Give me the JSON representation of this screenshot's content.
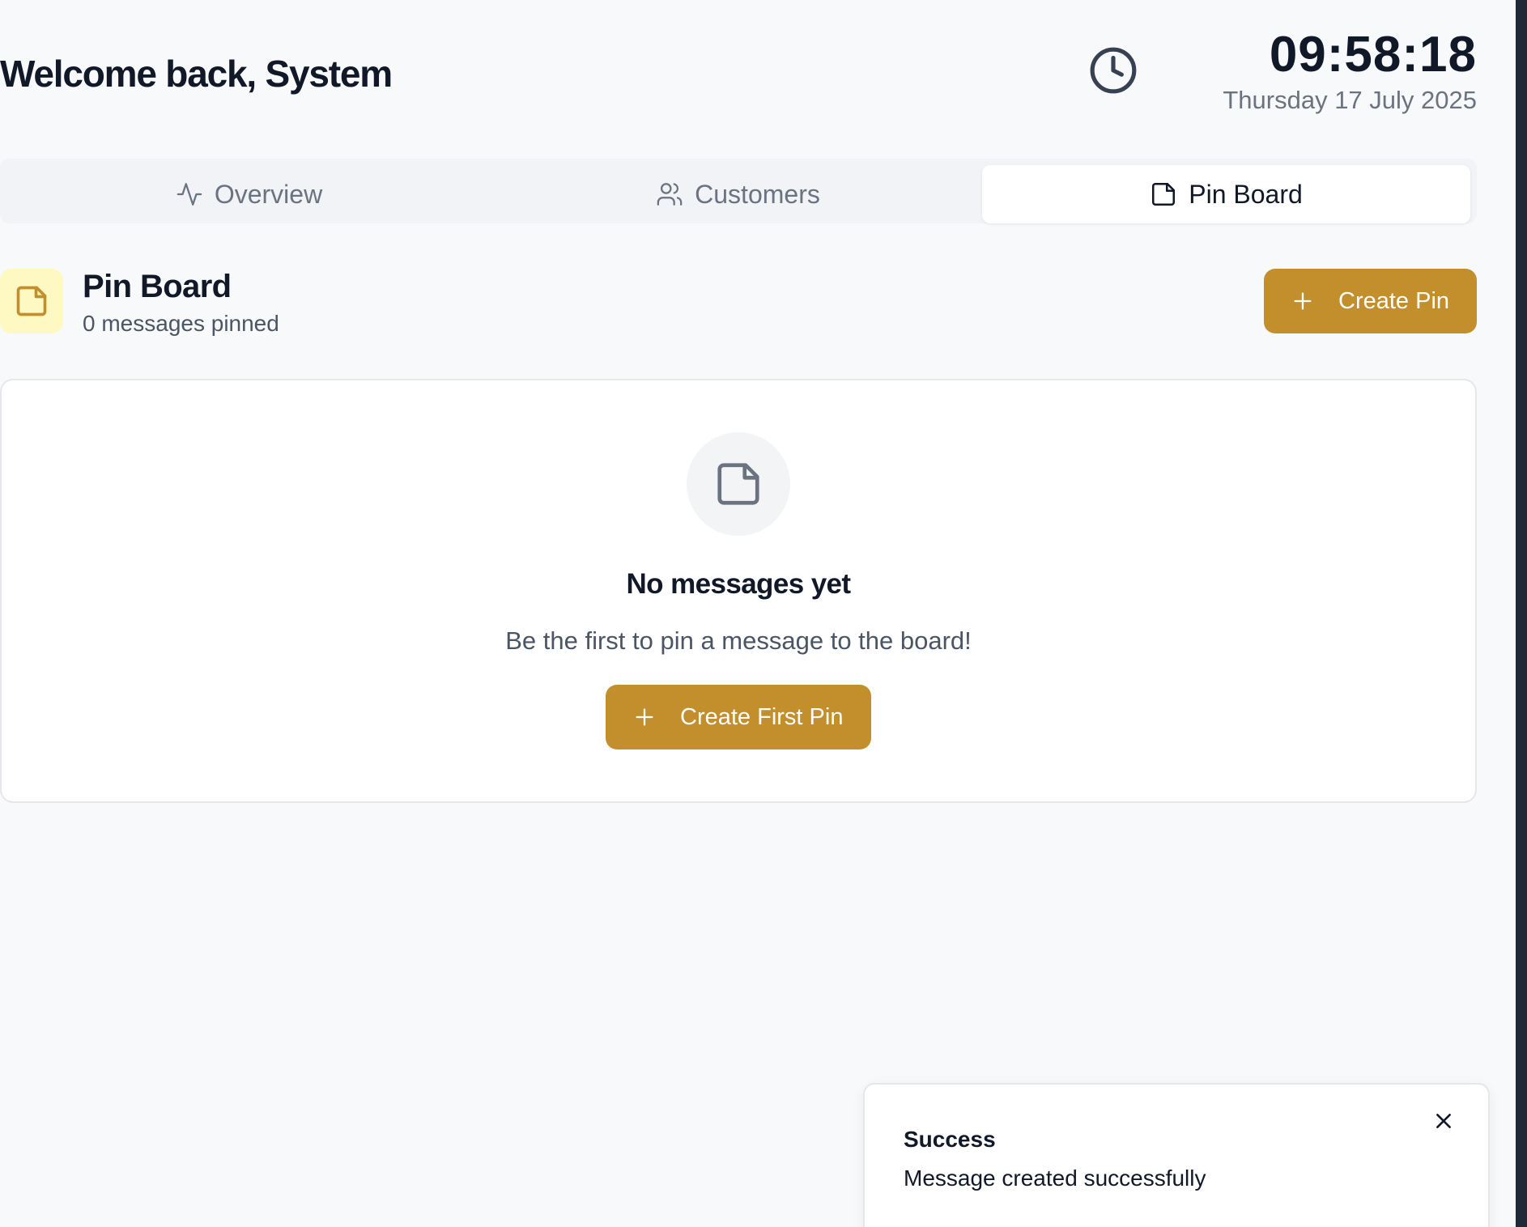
{
  "header": {
    "welcome": "Welcome back, System",
    "time": "09:58:18",
    "date": "Thursday 17 July 2025"
  },
  "tabs": [
    {
      "label": "Overview",
      "icon": "activity-icon",
      "active": false
    },
    {
      "label": "Customers",
      "icon": "users-icon",
      "active": false
    },
    {
      "label": "Pin Board",
      "icon": "sticky-note-icon",
      "active": true
    }
  ],
  "pinboard": {
    "title": "Pin Board",
    "count_text": "0 messages pinned",
    "create_label": "Create Pin",
    "empty_title": "No messages yet",
    "empty_sub": "Be the first to pin a message to the board!",
    "create_first_label": "Create First Pin"
  },
  "toast": {
    "title": "Success",
    "message": "Message created successfully"
  },
  "colors": {
    "accent": "#c28f2c",
    "background": "#f8f9fb",
    "icon_badge": "#fef9c3"
  }
}
